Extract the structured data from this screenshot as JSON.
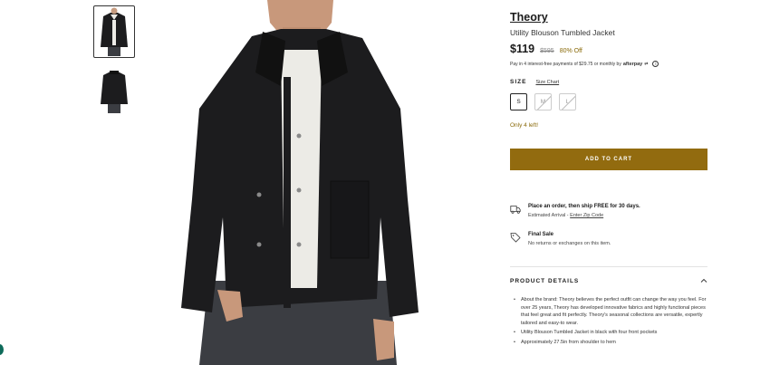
{
  "product": {
    "brand": "Theory",
    "name": "Utility Blouson Tumbled Jacket",
    "price": "$119",
    "compare_price": "$595",
    "discount": "80% Off"
  },
  "afterpay": {
    "text": "Pay in 4 interest-free payments of $29.75 or monthly by",
    "brand": "afterpay",
    "info_icon": "i"
  },
  "size": {
    "label": "SIZE",
    "chart_link": "Size Chart",
    "options": [
      "S",
      "M",
      "L"
    ],
    "selected": "S"
  },
  "stock_text": "Only 4 left!",
  "add_to_cart_label": "ADD TO CART",
  "shipping": {
    "title": "Place an order, then ship FREE for 30 days.",
    "sub_prefix": "Estimated Arrival - ",
    "sub_link": "Enter Zip Code"
  },
  "final_sale": {
    "title": "Final Sale",
    "sub": "No returns or exchanges on this item."
  },
  "details": {
    "title": "PRODUCT DETAILS",
    "items": [
      "About the brand: Theory believes the perfect outfit can change the way you feel. For over 25 years, Theory has developed innovative fabrics and highly functional pieces that feel great and fit perfectly. Theory's seasonal collections are versatile, expertly tailored and easy-to wear.",
      "Utility Blouson Tumbled Jacket in black with four front pockets",
      "Approximately 27.5in from shoulder to hem"
    ]
  },
  "colors": {
    "accent": "#926b0f",
    "discount": "#8a6a0a",
    "jacket": "#1c1c1e",
    "shirt": "#ecebe6",
    "jeans": "#3b3d42"
  },
  "icons": {
    "shipping": "truck-icon",
    "final_sale": "tag-icon",
    "collapse": "chevron-up-icon"
  }
}
